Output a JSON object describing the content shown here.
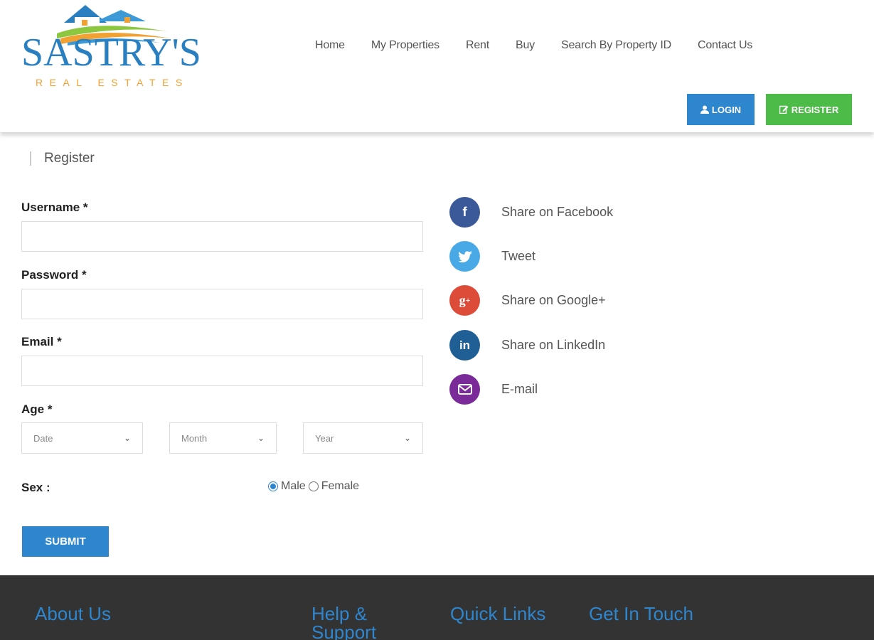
{
  "brand": {
    "name": "SASTRY'S",
    "tagline": "REAL ESTATES",
    "primary_color": "#2a7fc1",
    "accent_color": "#f0a131"
  },
  "nav": {
    "items": [
      "Home",
      "My Properties",
      "Rent",
      "Buy",
      "Search By Property ID",
      "Contact Us"
    ]
  },
  "header_buttons": {
    "login": "LOGIN",
    "register": "REGISTER"
  },
  "breadcrumb": {
    "current": "Register"
  },
  "form": {
    "username_label": "Username *",
    "username_value": "",
    "password_label": "Password *",
    "password_value": "",
    "email_label": "Email *",
    "email_value": "",
    "age_label": "Age *",
    "age_date": "Date",
    "age_month": "Month",
    "age_year": "Year",
    "sex_label": "Sex :",
    "sex_options": [
      "Male",
      "Female"
    ],
    "sex_selected": "Male",
    "submit_label": "SUBMIT"
  },
  "social": {
    "items": [
      {
        "label": "Share on Facebook",
        "icon": "facebook-icon",
        "color": "#3b5998"
      },
      {
        "label": "Tweet",
        "icon": "twitter-icon",
        "color": "#48a9e6"
      },
      {
        "label": "Share on Google+",
        "icon": "google-plus-icon",
        "color": "#dd4b39"
      },
      {
        "label": "Share on LinkedIn",
        "icon": "linkedin-icon",
        "color": "#1f5f95"
      },
      {
        "label": "E-mail",
        "icon": "email-icon",
        "color": "#7b2a99"
      }
    ]
  },
  "footer": {
    "headings": [
      "About Us",
      "Help & Support",
      "Quick Links",
      "Get In Touch"
    ]
  }
}
